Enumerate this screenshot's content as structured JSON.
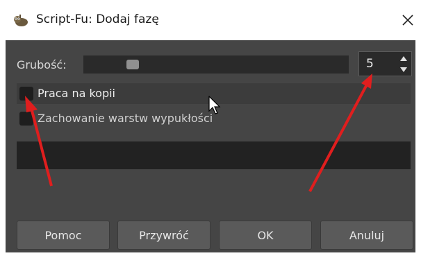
{
  "window": {
    "title": "Script-Fu: Dodaj fazę",
    "icon": "gimp-wilber-icon",
    "close_icon": "close-icon"
  },
  "controls": {
    "thickness_label": "Grubość:",
    "thickness_value": "5",
    "thickness_slider_level": 0.17,
    "checkbox_work_on_copy_label": "Praca na kopii",
    "checkbox_work_on_copy_checked": false,
    "checkbox_keep_bump_layer_label": "Zachowanie warstw wypukłości",
    "checkbox_keep_bump_layer_checked": false
  },
  "buttons": {
    "help": "Pomoc",
    "reset": "Przywróć",
    "ok": "OK",
    "cancel": "Anuluj"
  },
  "colors": {
    "dialog_background": "#454545",
    "annotation_arrow": "#e01e1e"
  }
}
